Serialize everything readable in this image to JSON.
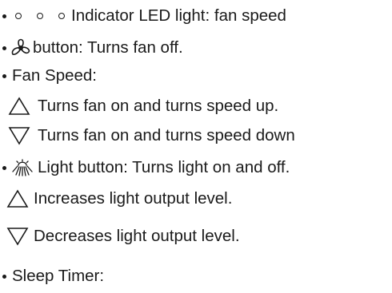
{
  "lines": {
    "led_indicator": "Indicator LED light: fan speed",
    "fan_off": "button: Turns fan off.",
    "fan_speed": "Fan Speed:",
    "speed_up": "Turns fan on and turns speed up.",
    "speed_down": "Turns fan on and turns speed down",
    "light_button": "Light button: Turns light on and off.",
    "light_up": "Increases light output level.",
    "light_down": "Decreases light output level.",
    "sleep_timer": "Sleep Timer:"
  },
  "icons": {
    "led": "led-circle-icon",
    "fan": "fan-icon",
    "up": "triangle-up-icon",
    "down": "triangle-down-icon",
    "light": "light-icon"
  },
  "colors": {
    "text": "#1a1a1a",
    "background": "#ffffff"
  }
}
